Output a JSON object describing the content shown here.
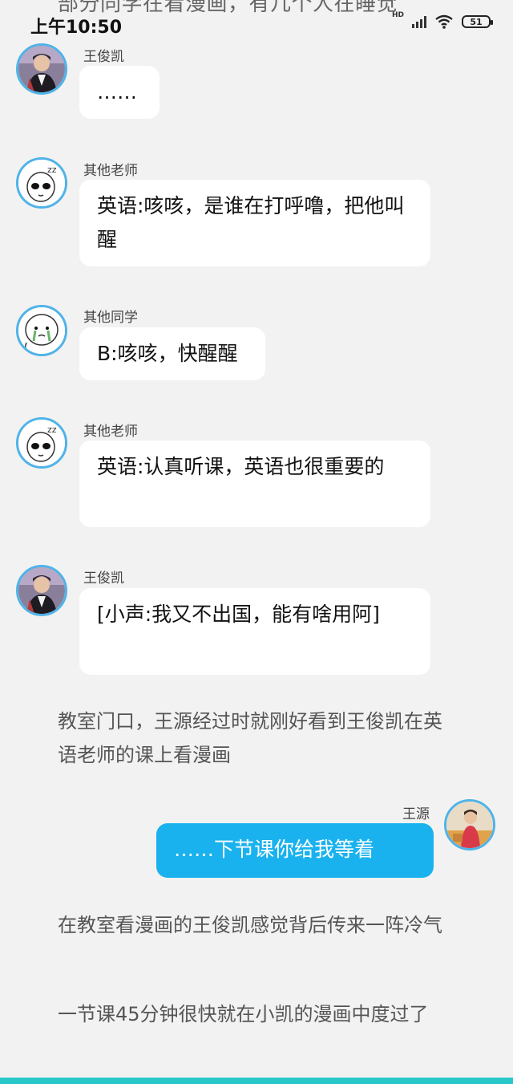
{
  "status": {
    "time": "上午10:50",
    "hd": "HD",
    "battery": "51"
  },
  "top_cut_text": "部分同学在看漫画，有几个人在睡觉",
  "messages": [
    {
      "sender": "王俊凯",
      "text": "……"
    },
    {
      "sender": "其他老师",
      "text": "英语:咳咳，是谁在打呼噜，把他叫醒"
    },
    {
      "sender": "其他同学",
      "text": "B:咳咳，快醒醒"
    },
    {
      "sender": "其他老师",
      "text": "英语:认真听课，英语也很重要的"
    },
    {
      "sender": "王俊凯",
      "text": "[小声:我又不出国，能有啥用阿]"
    },
    {
      "sender": "王源",
      "text": "……下节课你给我等着"
    }
  ],
  "narration": [
    "教室门口，王源经过时就刚好看到王俊凯在英语老师的课上看漫画",
    "在教室看漫画的王俊凯感觉背后传来一阵冷气",
    "一节课45分钟很快就在小凯的漫画中度过了"
  ],
  "colors": {
    "accent": "#1ab2ee",
    "avatar_ring": "#4fb3e8",
    "background": "#f2f2f2",
    "bottom_bar": "#29c8c8"
  }
}
